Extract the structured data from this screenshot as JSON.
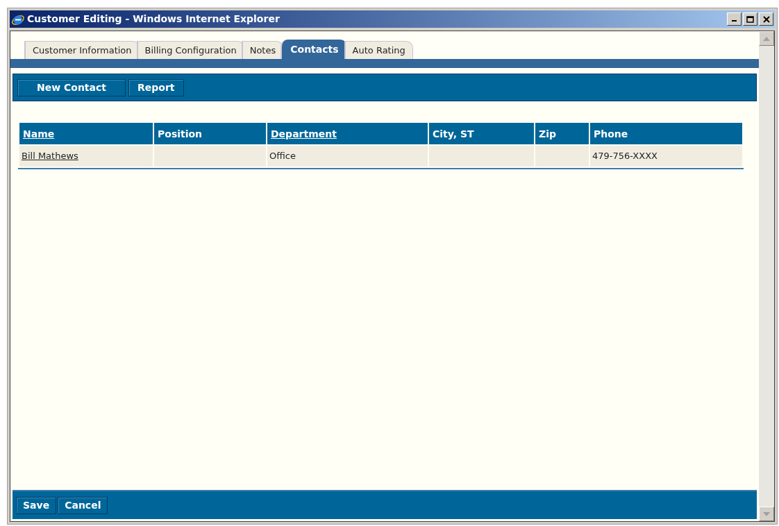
{
  "window": {
    "title": "Customer Editing - Windows Internet Explorer"
  },
  "tabs": [
    {
      "label": "Customer Information",
      "selected": false
    },
    {
      "label": "Billing Configuration",
      "selected": false
    },
    {
      "label": "Notes",
      "selected": false
    },
    {
      "label": "Contacts",
      "selected": true
    },
    {
      "label": "Auto Rating",
      "selected": false
    }
  ],
  "toolbar": {
    "buttons": [
      "New Contact",
      "Report"
    ]
  },
  "table": {
    "columns": [
      {
        "label": "Name",
        "sortable": true
      },
      {
        "label": "Position",
        "sortable": false
      },
      {
        "label": "Department",
        "sortable": true
      },
      {
        "label": "City, ST",
        "sortable": false
      },
      {
        "label": "Zip",
        "sortable": false
      },
      {
        "label": "Phone",
        "sortable": false
      }
    ],
    "rows": [
      [
        {
          "text": "Bill Mathews",
          "kind": "link"
        },
        {
          "text": "",
          "kind": "text"
        },
        {
          "text": "Office",
          "kind": "text"
        },
        {
          "text": "",
          "kind": "text"
        },
        {
          "text": "",
          "kind": "text"
        },
        {
          "text": "479-756-XXXX",
          "kind": "text"
        }
      ]
    ]
  },
  "footer": {
    "buttons": [
      "Save",
      "Cancel"
    ]
  }
}
